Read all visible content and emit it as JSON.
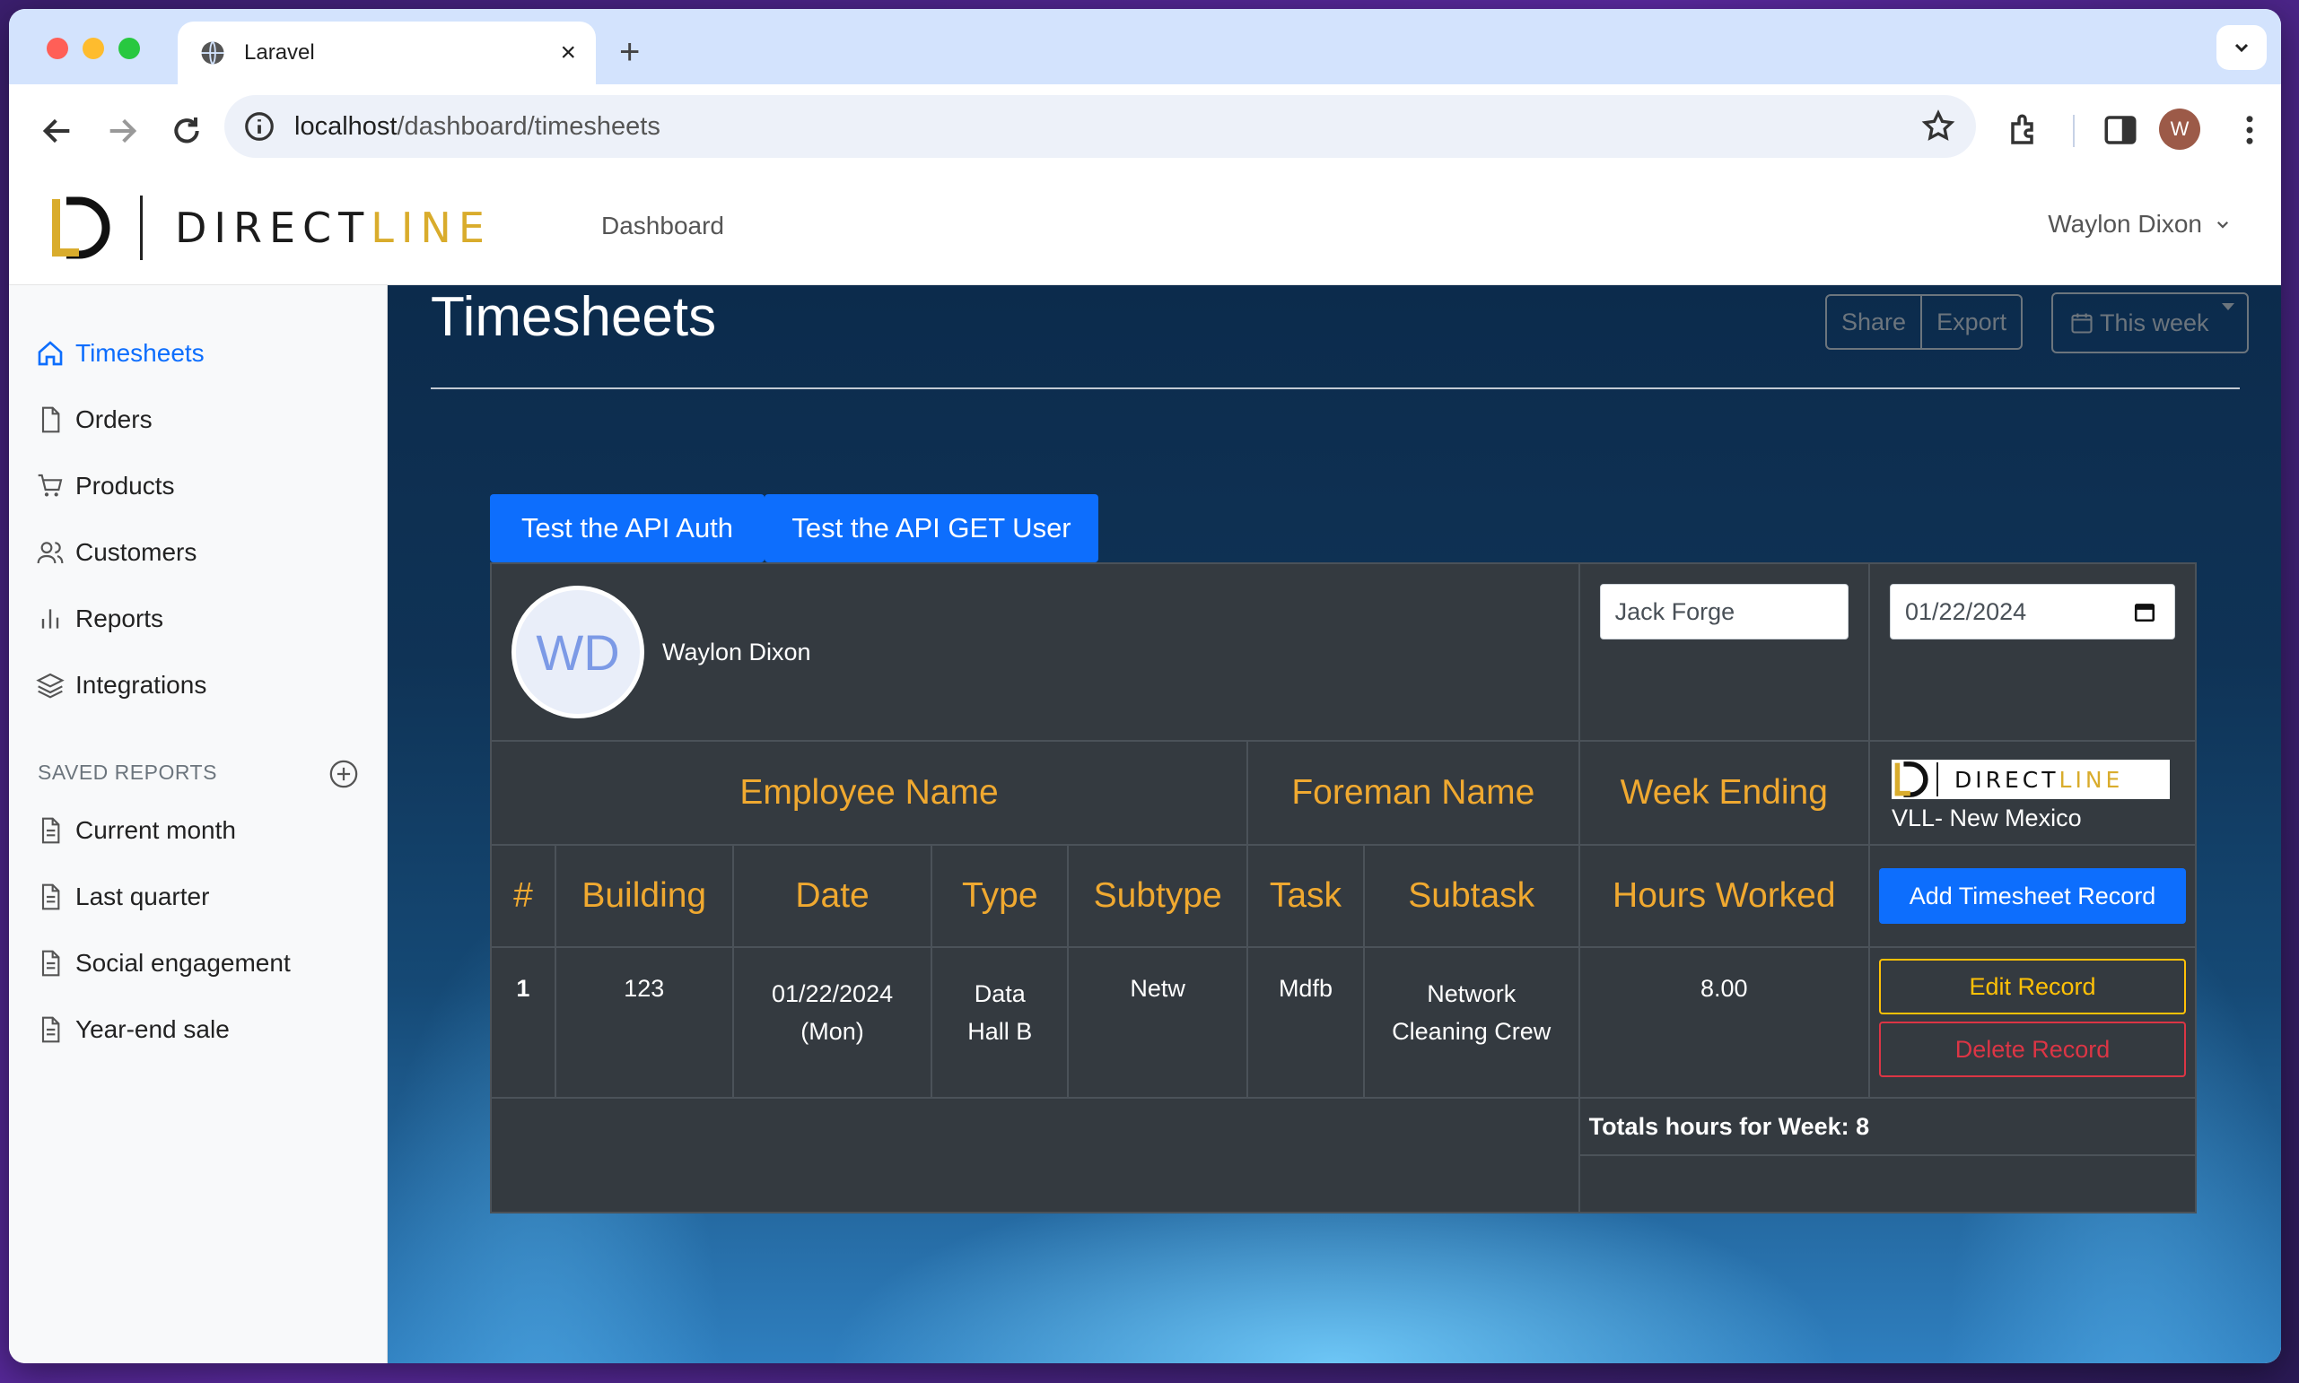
{
  "browser": {
    "tab_title": "Laravel",
    "url_host": "localhost",
    "url_path": "/dashboard/timesheets",
    "profile_initial": "W"
  },
  "header": {
    "brand_dark": "DIRECT",
    "brand_gold": "LINE",
    "nav_link": "Dashboard",
    "user_name": "Waylon Dixon"
  },
  "sidebar": {
    "items": [
      {
        "label": "Timesheets",
        "icon": "home-icon"
      },
      {
        "label": "Orders",
        "icon": "file-icon"
      },
      {
        "label": "Products",
        "icon": "cart-icon"
      },
      {
        "label": "Customers",
        "icon": "users-icon"
      },
      {
        "label": "Reports",
        "icon": "bar-chart-icon"
      },
      {
        "label": "Integrations",
        "icon": "layers-icon"
      }
    ],
    "saved_heading": "SAVED REPORTS",
    "saved": [
      {
        "label": "Current month"
      },
      {
        "label": "Last quarter"
      },
      {
        "label": "Social engagement"
      },
      {
        "label": "Year-end sale"
      }
    ]
  },
  "main": {
    "title": "Timesheets",
    "share_label": "Share",
    "export_label": "Export",
    "week_label": "This week",
    "api_auth_label": "Test the API Auth",
    "api_get_user_label": "Test the API GET User"
  },
  "timesheet": {
    "avatar_initials": "WD",
    "employee_name": "Waylon Dixon",
    "foreman_value": "Jack Forge",
    "week_ending_value": "01/22/2024",
    "company_brand_dark": "DIRECT",
    "company_brand_gold": "LINE",
    "company_location": "VLL- New Mexico",
    "headers": {
      "employee_name": "Employee Name",
      "foreman_name": "Foreman Name",
      "week_ending": "Week Ending"
    },
    "columns": [
      "#",
      "Building",
      "Date",
      "Type",
      "Subtype",
      "Task",
      "Subtask",
      "Hours Worked"
    ],
    "add_record_label": "Add Timesheet Record",
    "rows": [
      {
        "num": "1",
        "building": "123",
        "date": "01/22/2024",
        "day": "(Mon)",
        "type_line1": "Data",
        "type_line2": "Hall B",
        "subtype": "Netw",
        "task": "Mdfb",
        "subtask_line1": "Network",
        "subtask_line2": "Cleaning Crew",
        "hours": "8.00",
        "edit_label": "Edit Record",
        "delete_label": "Delete Record"
      }
    ],
    "totals_label": "Totals hours for Week: 8"
  },
  "colors": {
    "accent_blue": "#0d6efd",
    "header_gold": "#f0a930",
    "table_bg": "#343a40",
    "brand_gold": "#d9ac2c"
  }
}
